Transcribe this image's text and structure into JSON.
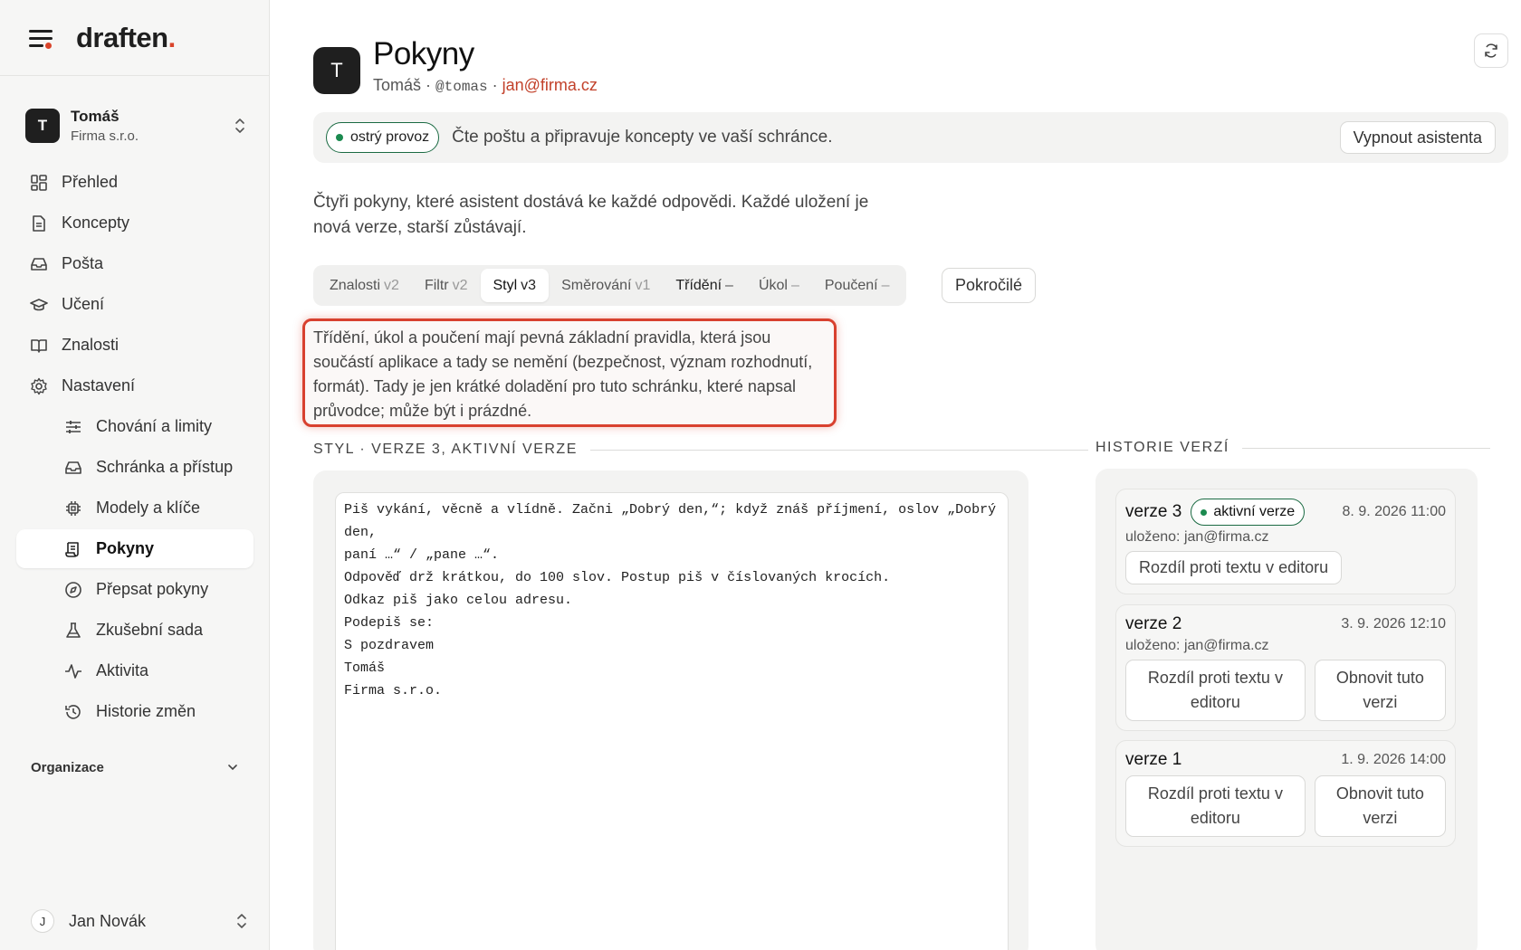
{
  "brand": {
    "name": "draften",
    "dot": "."
  },
  "account": {
    "initial": "T",
    "name": "Tomáš",
    "org": "Firma s.r.o."
  },
  "nav": {
    "items": [
      {
        "label": "Přehled",
        "icon": "grid-icon"
      },
      {
        "label": "Koncepty",
        "icon": "document-icon"
      },
      {
        "label": "Pošta",
        "icon": "inbox-icon"
      },
      {
        "label": "Učení",
        "icon": "graduation-cap-icon"
      },
      {
        "label": "Znalosti",
        "icon": "book-icon"
      },
      {
        "label": "Nastavení",
        "icon": "gear-icon"
      }
    ],
    "sub_items": [
      {
        "label": "Chování a limity",
        "icon": "sliders-icon"
      },
      {
        "label": "Schránka a přístup",
        "icon": "inbox-icon"
      },
      {
        "label": "Modely a klíče",
        "icon": "chip-icon"
      },
      {
        "label": "Pokyny",
        "icon": "scroll-icon",
        "active": true
      },
      {
        "label": "Přepsat pokyny",
        "icon": "compass-icon"
      },
      {
        "label": "Zkušební sada",
        "icon": "flask-icon"
      },
      {
        "label": "Aktivita",
        "icon": "activity-icon"
      },
      {
        "label": "Historie změn",
        "icon": "history-icon"
      }
    ],
    "section": "Organizace"
  },
  "user": {
    "initial": "J",
    "name": "Jan Novák"
  },
  "page": {
    "avatar": "T",
    "title": "Pokyny",
    "sub_name": "Tomáš",
    "sub_sep": " · ",
    "handle": "@tomas",
    "email": "jan@firma.cz"
  },
  "status": {
    "pill": "ostrý provoz",
    "text": "Čte poštu a připravuje koncepty ve vaší schránce.",
    "button": "Vypnout asistenta"
  },
  "intro": "Čtyři pokyny, které asistent dostává ke každé odpovědi. Každé uložení je nová verze, starší zůstávají.",
  "tabs": [
    {
      "label": "Znalosti",
      "ver": "v2"
    },
    {
      "label": "Filtr",
      "ver": "v2"
    },
    {
      "label": "Styl",
      "ver": "v3",
      "active": true
    },
    {
      "label": "Směrování",
      "ver": "v1"
    },
    {
      "label": "Třídění",
      "ver": "–"
    },
    {
      "label": "Úkol",
      "ver": "–"
    },
    {
      "label": "Poučení",
      "ver": "–"
    }
  ],
  "advanced_button": "Pokročilé",
  "note": "Třídění, úkol a poučení mají pevná základní pravidla, která jsou součástí aplikace a tady se nemění (bezpečnost, význam rozhodnutí, formát). Tady je jen krátké doladění pro tuto schránku, které napsal průvodce; může být i prázdné.",
  "editor": {
    "label": "STYL · VERZE 3, AKTIVNÍ VERZE",
    "text": "Piš vykání, věcně a vlídně. Začni „Dobrý den,“; když znáš příjmení, oslov „Dobrý den,\npaní …“ / „pane …“.\nOdpověď drž krátkou, do 100 slov. Postup piš v číslovaných krocích.\nOdkaz piš jako celou adresu.\nPodepiš se:\nS pozdravem\nTomáš\nFirma s.r.o."
  },
  "history": {
    "label": "HISTORIE VERZÍ",
    "versions": [
      {
        "title": "verze 3",
        "badge": "aktivní verze",
        "date": "8. 9. 2026 11:00",
        "by": "uloženo: jan@firma.cz",
        "diff": "Rozdíl proti textu v editoru"
      },
      {
        "title": "verze 2",
        "date": "3. 9. 2026 12:10",
        "by": "uloženo: jan@firma.cz",
        "diff": "Rozdíl proti textu v editoru",
        "restore": "Obnovit tuto verzi"
      },
      {
        "title": "verze 1",
        "date": "1. 9. 2026 14:00",
        "diff": "Rozdíl proti textu v editoru",
        "restore": "Obnovit tuto verzi"
      }
    ]
  },
  "colors": {
    "accent": "#d9442b",
    "active_green": "#1b8a4f",
    "highlight": "#d8412f"
  }
}
